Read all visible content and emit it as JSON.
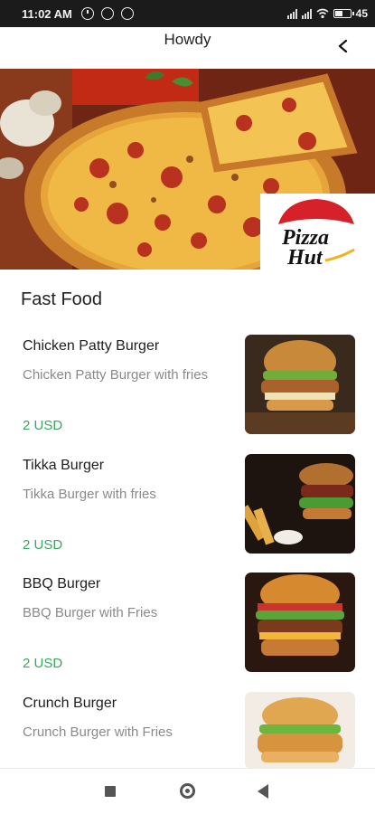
{
  "status_bar": {
    "time": "11:02 AM",
    "battery": "45"
  },
  "app_bar": {
    "title": "Howdy"
  },
  "hero": {
    "logo_text": "Pizza Hut",
    "slide_count": 2,
    "active_slide": 2
  },
  "section": {
    "title": "Fast Food"
  },
  "items": [
    {
      "name": "Chicken Patty Burger",
      "description": "Chicken Patty Burger  with fries",
      "price": "2 USD"
    },
    {
      "name": "Tikka Burger",
      "description": "Tikka Burger with fries",
      "price": "2 USD"
    },
    {
      "name": "BBQ Burger",
      "description": "BBQ Burger with Fries",
      "price": "2 USD"
    },
    {
      "name": "Crunch Burger",
      "description": "Crunch Burger with Fries",
      "price": ""
    }
  ],
  "colors": {
    "price": "#3aa55d",
    "status_bar": "#1b1b1b",
    "pizza_hut_red": "#d6202a"
  },
  "icons": [
    "alarm-icon",
    "sync-icon",
    "sync-icon",
    "signal-icon",
    "wifi-icon",
    "battery-icon",
    "back-chevron-icon",
    "nav-recents-icon",
    "nav-home-icon",
    "nav-back-icon"
  ]
}
